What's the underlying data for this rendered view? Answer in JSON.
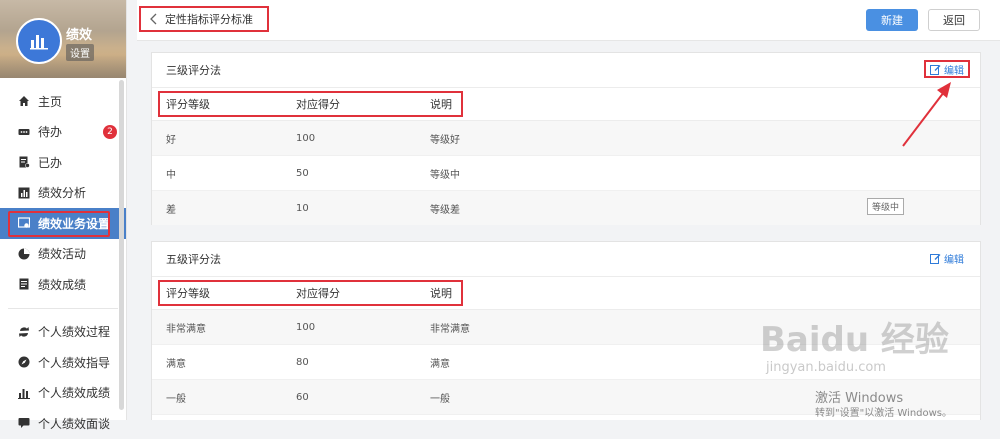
{
  "sidebar": {
    "profile_name": "绩效",
    "profile_tag": "设置",
    "badge": "2",
    "items": [
      {
        "label": "主页"
      },
      {
        "label": "待办"
      },
      {
        "label": "已办"
      },
      {
        "label": "绩效分析"
      },
      {
        "label": "绩效业务设置"
      },
      {
        "label": "绩效活动"
      },
      {
        "label": "绩效成绩"
      },
      {
        "label": "个人绩效过程"
      },
      {
        "label": "个人绩效指导"
      },
      {
        "label": "个人绩效成绩"
      },
      {
        "label": "个人绩效面谈"
      }
    ]
  },
  "header": {
    "back_label": "定性指标评分标准",
    "new_label": "新建",
    "return_label": "返回"
  },
  "panels": [
    {
      "title": "三级评分法",
      "edit_label": "编辑",
      "columns": [
        "评分等级",
        "对应得分",
        "说明"
      ],
      "rows": [
        [
          "好",
          "100",
          "等级好"
        ],
        [
          "中",
          "50",
          "等级中"
        ],
        [
          "差",
          "10",
          "等级差"
        ]
      ],
      "tooltip": "等级中"
    },
    {
      "title": "五级评分法",
      "edit_label": "编辑",
      "columns": [
        "评分等级",
        "对应得分",
        "说明"
      ],
      "rows": [
        [
          "非常满意",
          "100",
          "非常满意"
        ],
        [
          "满意",
          "80",
          "满意"
        ],
        [
          "一般",
          "60",
          "一般"
        ]
      ]
    }
  ],
  "watermark": {
    "text": "Baidu 经验",
    "sub": "jingyan.baidu.com"
  },
  "windows_activation": {
    "line1": "激活 Windows",
    "line2": "转到\"设置\"以激活 Windows。"
  },
  "colors": {
    "accent": "#4a90e2",
    "active_nav": "#4a80c8",
    "highlight": "#e0313b"
  }
}
